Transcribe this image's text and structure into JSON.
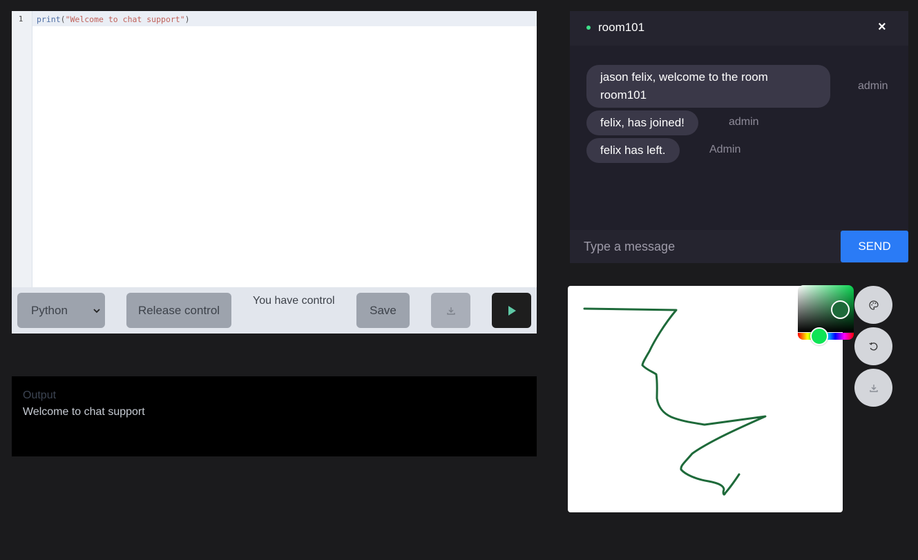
{
  "editor": {
    "line_number": "1",
    "code": {
      "fn": "print",
      "open": "(",
      "string": "\"Welcome to chat support\"",
      "close": ")"
    }
  },
  "toolbar": {
    "language_options": [
      "Python"
    ],
    "language_selected": "Python",
    "release_label": "Release control",
    "control_status": "You have control",
    "save_label": "Save",
    "download_icon": "download-icon",
    "run_icon": "play-icon"
  },
  "output": {
    "label": "Output",
    "text": "Welcome to chat support"
  },
  "chat": {
    "room": "room101",
    "status_color": "#3ee089",
    "close_label": "×",
    "messages": [
      {
        "text": "jason felix, welcome to the room room101",
        "sender": "admin"
      },
      {
        "text": "felix, has joined!",
        "sender": "admin"
      },
      {
        "text": "felix has left.",
        "sender": "Admin"
      }
    ],
    "input_placeholder": "Type a message",
    "send_label": "SEND",
    "send_color": "#2a7bf6"
  },
  "drawing": {
    "stroke_color": "#1e6a3a",
    "tools": [
      "palette-icon",
      "undo-icon",
      "download-icon"
    ]
  }
}
